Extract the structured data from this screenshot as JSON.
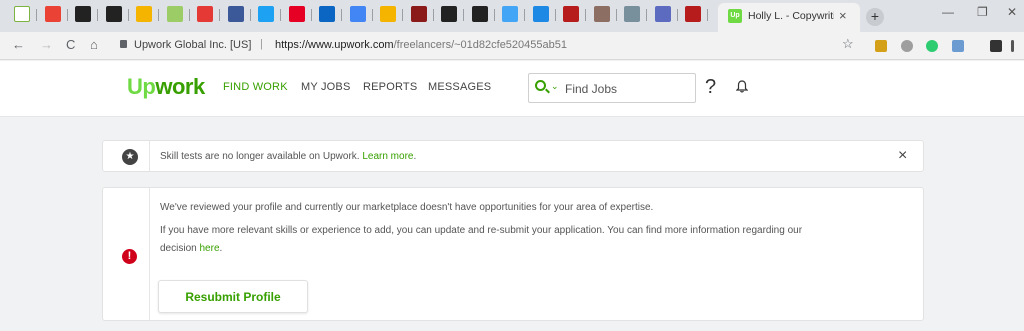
{
  "browser": {
    "active_tab_title": "Holly L. - Copywriting",
    "active_tab_favicon": "Up",
    "tab_close": "×",
    "new_tab": "+",
    "tab_favicon_colors": [
      "#ffffff",
      "#ea4335",
      "#222222",
      "#222222",
      "#f4b400",
      "#9ccc65",
      "#e53935",
      "#3b5998",
      "#1da1f2",
      "#e60023",
      "#0a66c2",
      "#4285f4",
      "#f4b400",
      "#8b1a1a",
      "#222222",
      "#222222",
      "#42a5f5",
      "#1e88e5",
      "#b71c1c",
      "#8d6e63",
      "#78909c",
      "#5c6bc0",
      "#b71c1c"
    ],
    "site_identity": "Upwork Global Inc. [US]",
    "url_host": "https://www.upwork.com",
    "url_path": "/freelancers/~01d82cfe520455ab51",
    "url_separator": "|",
    "nav": {
      "back": "←",
      "forward": "→",
      "reload": "C",
      "home": "⌂"
    },
    "window_controls": {
      "minimize": "—",
      "maximize": "❐",
      "close": "✕"
    }
  },
  "header": {
    "logo_up": "Up",
    "logo_work": "work",
    "nav": [
      {
        "label": "FIND WORK",
        "active": true
      },
      {
        "label": "MY JOBS",
        "active": false
      },
      {
        "label": "REPORTS",
        "active": false
      },
      {
        "label": "MESSAGES",
        "active": false
      }
    ],
    "search_placeholder": "Find Jobs",
    "search_dropdown": "⌄",
    "help": "?"
  },
  "notice": {
    "icon": "★",
    "text": "Skill tests are no longer available on Upwork.",
    "link": "Learn more",
    "trailing": ".",
    "close": "×"
  },
  "alert": {
    "icon": "!",
    "line1": "We've reviewed your profile and currently our marketplace doesn't have opportunities for your area of expertise.",
    "line2": "If you have more relevant skills or experience to add, you can update and re-submit your application. You can find more information regarding our",
    "line3_prefix": "decision",
    "line3_link": "here",
    "line3_suffix": ".",
    "button": "Resubmit Profile"
  },
  "colors": {
    "brand_green": "#37a000",
    "logo_green": "#6fda44",
    "error_red": "#d0021b"
  }
}
